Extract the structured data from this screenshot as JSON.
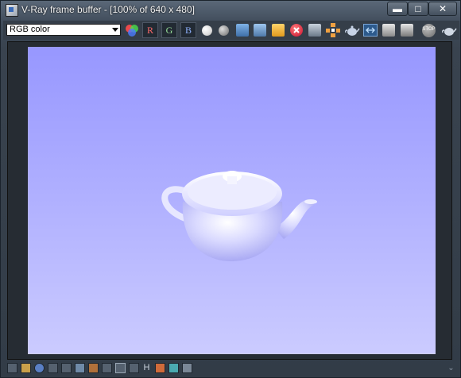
{
  "window": {
    "title": "V-Ray frame buffer - [100% of 640 x 480]",
    "controls": {
      "minimize": "▬",
      "maximize": "□",
      "close": "✕"
    }
  },
  "toolbar": {
    "channel_select": {
      "value": "RGB color"
    },
    "channel_buttons": {
      "r": "R",
      "g": "G",
      "b": "B"
    },
    "icons": [
      "color-balls-icon",
      "white-sphere-icon",
      "gray-sphere-icon",
      "save-icon",
      "save-all-icon",
      "open-folder-icon",
      "clear-icon",
      "duplicate-icon",
      "track-mouse-icon",
      "teapot-render-icon",
      "region-render-icon",
      "lock-icon",
      "history-icon",
      "stop-icon",
      "render-teapot-icon"
    ],
    "stop_label": "STOP"
  },
  "viewport": {
    "background_top": "#9797ff",
    "background_bottom": "#cbcbff",
    "object": "teapot"
  },
  "statusbar": {
    "icons": [
      "color-corrections-icon",
      "info-icon",
      "levels-icon",
      "curves-icon",
      "histogram-icon",
      "lut-icon",
      "exposure-icon",
      "pixel-aspect-icon",
      "compare-icon",
      "h-icon",
      "horizontal-flip-icon",
      "vertical-flip-icon",
      "settings-icon"
    ],
    "h_label": "H"
  }
}
